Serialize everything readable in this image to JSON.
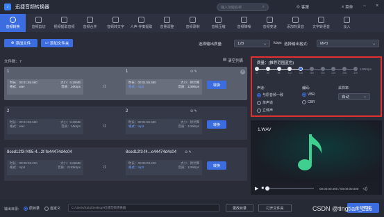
{
  "app": {
    "title": "迅捷音频转换器",
    "logo_glyph": "♪"
  },
  "search": {
    "placeholder": "输入功能名称"
  },
  "titlebar": {
    "customer_service": "客服",
    "menu": "菜单"
  },
  "tools": [
    {
      "label": "音频转换",
      "active": true
    },
    {
      "label": "音频剪切",
      "active": false
    },
    {
      "label": "视频提取音频",
      "active": false
    },
    {
      "label": "音频合并",
      "active": false
    },
    {
      "label": "音频转文字",
      "active": false
    },
    {
      "label": "人声-伴奏提取",
      "active": false
    },
    {
      "label": "音量调整",
      "active": false
    },
    {
      "label": "音频录制",
      "active": false
    },
    {
      "label": "音频压缩",
      "active": false
    },
    {
      "label": "音频降噪",
      "active": false
    },
    {
      "label": "音频变速",
      "active": false
    },
    {
      "label": "添加背景音",
      "active": false
    },
    {
      "label": "文字转语音",
      "active": false
    },
    {
      "label": "淡入",
      "active": false
    }
  ],
  "actions": {
    "add_file": "添加文件",
    "add_folder": "添加文件夹",
    "quality_label": "选择输出质量:",
    "quality_value": "128",
    "quality_unit": "kbps",
    "format_label": "选择输出格式:",
    "format_value": "MP3"
  },
  "list": {
    "count_label": "文件数：7",
    "clear": "清空列表"
  },
  "files": [
    {
      "name_in": "1",
      "name_out": "1",
      "duration_in": "时长：00:01:55.580",
      "size_in": "大小：0.20MB",
      "format_in": "格式：wav",
      "bitrate_in": "音质：14kbps",
      "duration_out": "时长：00:01:55.580",
      "size_out": "大小：待计算",
      "format_out": "格式：mp3",
      "bitrate_out": "音质：128kbps",
      "convert": "转换"
    },
    {
      "name_in": "2",
      "name_out": "2",
      "duration_in": "时长：00:01:55.580",
      "size_in": "大小：0.20MB",
      "format_in": "格式：wav",
      "bitrate_in": "音质：14kbps",
      "duration_out": "时长：00:01:55.580",
      "size_out": "大小：待计算",
      "format_out": "格式：mp3",
      "bitrate_out": "音质：128kbps",
      "convert": "转换"
    },
    {
      "name_in": "8ced12f3-f495-4...2f-fe44474d4c04",
      "name_out": "8ced12f3-f4...e44474d4c04",
      "duration_in": "时长：00:05:03.220",
      "size_in": "大小：8.66MB",
      "format_in": "格式：mp4",
      "bitrate_in": "音质：2193kbps",
      "duration_out": "时长：00:05:03.220",
      "size_out": "大小：待计算",
      "format_out": "格式：mp3",
      "bitrate_out": "音质：128kbps",
      "convert": "转换"
    }
  ],
  "settings": {
    "quality_title": "质量：(推荐范围蓝色)",
    "ticks": [
      "32",
      "64",
      "96",
      "112",
      "128",
      "160",
      "192",
      "224",
      "256",
      "320"
    ],
    "selected_tick": "128",
    "unit_readout": "128kbps",
    "channel_label": "声道:",
    "channel_options": [
      "与原音频一致",
      "单声道",
      "立体声"
    ],
    "channel_selected": "与原音频一致",
    "encoding_label": "编码:",
    "encoding_options": [
      "VBR",
      "CBR"
    ],
    "encoding_selected": "VBR",
    "samplerate_label": "采样率:",
    "samplerate_value": "自动"
  },
  "preview": {
    "filename": "1.WAV",
    "time": "00:00:00.000 / 00:00:00.000"
  },
  "bottom": {
    "output_label": "输出目录:",
    "opt_original": "原目录",
    "opt_custom": "自定义",
    "path": "C:/Users/Eulu/Desktop/迅捷音频转换器",
    "change_dir": "更改目录",
    "open_folder": "打开文件夹",
    "convert_all": "全部转换"
  },
  "watermark": "CSDN @tingtian_216",
  "colors": {
    "accent": "#3b6de0",
    "highlight_border": "#e0302f",
    "music_note": "#3fcf8e"
  }
}
